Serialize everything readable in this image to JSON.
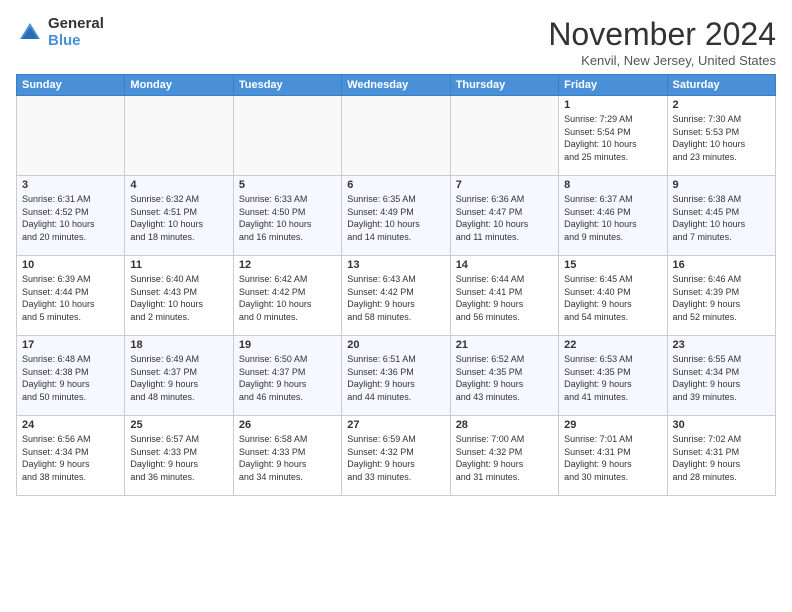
{
  "logo": {
    "general": "General",
    "blue": "Blue"
  },
  "title": "November 2024",
  "location": "Kenvil, New Jersey, United States",
  "days_of_week": [
    "Sunday",
    "Monday",
    "Tuesday",
    "Wednesday",
    "Thursday",
    "Friday",
    "Saturday"
  ],
  "weeks": [
    [
      {
        "day": "",
        "info": ""
      },
      {
        "day": "",
        "info": ""
      },
      {
        "day": "",
        "info": ""
      },
      {
        "day": "",
        "info": ""
      },
      {
        "day": "",
        "info": ""
      },
      {
        "day": "1",
        "info": "Sunrise: 7:29 AM\nSunset: 5:54 PM\nDaylight: 10 hours\nand 25 minutes."
      },
      {
        "day": "2",
        "info": "Sunrise: 7:30 AM\nSunset: 5:53 PM\nDaylight: 10 hours\nand 23 minutes."
      }
    ],
    [
      {
        "day": "3",
        "info": "Sunrise: 6:31 AM\nSunset: 4:52 PM\nDaylight: 10 hours\nand 20 minutes."
      },
      {
        "day": "4",
        "info": "Sunrise: 6:32 AM\nSunset: 4:51 PM\nDaylight: 10 hours\nand 18 minutes."
      },
      {
        "day": "5",
        "info": "Sunrise: 6:33 AM\nSunset: 4:50 PM\nDaylight: 10 hours\nand 16 minutes."
      },
      {
        "day": "6",
        "info": "Sunrise: 6:35 AM\nSunset: 4:49 PM\nDaylight: 10 hours\nand 14 minutes."
      },
      {
        "day": "7",
        "info": "Sunrise: 6:36 AM\nSunset: 4:47 PM\nDaylight: 10 hours\nand 11 minutes."
      },
      {
        "day": "8",
        "info": "Sunrise: 6:37 AM\nSunset: 4:46 PM\nDaylight: 10 hours\nand 9 minutes."
      },
      {
        "day": "9",
        "info": "Sunrise: 6:38 AM\nSunset: 4:45 PM\nDaylight: 10 hours\nand 7 minutes."
      }
    ],
    [
      {
        "day": "10",
        "info": "Sunrise: 6:39 AM\nSunset: 4:44 PM\nDaylight: 10 hours\nand 5 minutes."
      },
      {
        "day": "11",
        "info": "Sunrise: 6:40 AM\nSunset: 4:43 PM\nDaylight: 10 hours\nand 2 minutes."
      },
      {
        "day": "12",
        "info": "Sunrise: 6:42 AM\nSunset: 4:42 PM\nDaylight: 10 hours\nand 0 minutes."
      },
      {
        "day": "13",
        "info": "Sunrise: 6:43 AM\nSunset: 4:42 PM\nDaylight: 9 hours\nand 58 minutes."
      },
      {
        "day": "14",
        "info": "Sunrise: 6:44 AM\nSunset: 4:41 PM\nDaylight: 9 hours\nand 56 minutes."
      },
      {
        "day": "15",
        "info": "Sunrise: 6:45 AM\nSunset: 4:40 PM\nDaylight: 9 hours\nand 54 minutes."
      },
      {
        "day": "16",
        "info": "Sunrise: 6:46 AM\nSunset: 4:39 PM\nDaylight: 9 hours\nand 52 minutes."
      }
    ],
    [
      {
        "day": "17",
        "info": "Sunrise: 6:48 AM\nSunset: 4:38 PM\nDaylight: 9 hours\nand 50 minutes."
      },
      {
        "day": "18",
        "info": "Sunrise: 6:49 AM\nSunset: 4:37 PM\nDaylight: 9 hours\nand 48 minutes."
      },
      {
        "day": "19",
        "info": "Sunrise: 6:50 AM\nSunset: 4:37 PM\nDaylight: 9 hours\nand 46 minutes."
      },
      {
        "day": "20",
        "info": "Sunrise: 6:51 AM\nSunset: 4:36 PM\nDaylight: 9 hours\nand 44 minutes."
      },
      {
        "day": "21",
        "info": "Sunrise: 6:52 AM\nSunset: 4:35 PM\nDaylight: 9 hours\nand 43 minutes."
      },
      {
        "day": "22",
        "info": "Sunrise: 6:53 AM\nSunset: 4:35 PM\nDaylight: 9 hours\nand 41 minutes."
      },
      {
        "day": "23",
        "info": "Sunrise: 6:55 AM\nSunset: 4:34 PM\nDaylight: 9 hours\nand 39 minutes."
      }
    ],
    [
      {
        "day": "24",
        "info": "Sunrise: 6:56 AM\nSunset: 4:34 PM\nDaylight: 9 hours\nand 38 minutes."
      },
      {
        "day": "25",
        "info": "Sunrise: 6:57 AM\nSunset: 4:33 PM\nDaylight: 9 hours\nand 36 minutes."
      },
      {
        "day": "26",
        "info": "Sunrise: 6:58 AM\nSunset: 4:33 PM\nDaylight: 9 hours\nand 34 minutes."
      },
      {
        "day": "27",
        "info": "Sunrise: 6:59 AM\nSunset: 4:32 PM\nDaylight: 9 hours\nand 33 minutes."
      },
      {
        "day": "28",
        "info": "Sunrise: 7:00 AM\nSunset: 4:32 PM\nDaylight: 9 hours\nand 31 minutes."
      },
      {
        "day": "29",
        "info": "Sunrise: 7:01 AM\nSunset: 4:31 PM\nDaylight: 9 hours\nand 30 minutes."
      },
      {
        "day": "30",
        "info": "Sunrise: 7:02 AM\nSunset: 4:31 PM\nDaylight: 9 hours\nand 28 minutes."
      }
    ]
  ]
}
